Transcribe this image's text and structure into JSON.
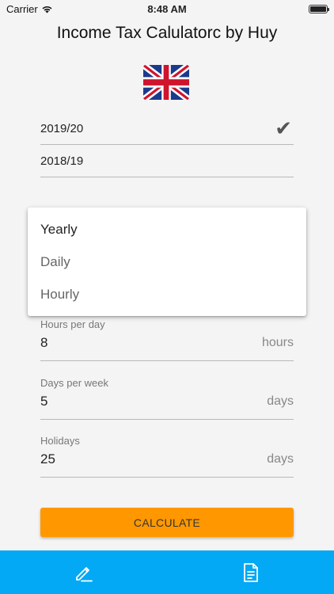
{
  "status": {
    "carrier": "Carrier",
    "time": "8:48 AM"
  },
  "app": {
    "title": "Income Tax Calulatorc by Huy"
  },
  "years": [
    {
      "label": "2019/20",
      "selected": true
    },
    {
      "label": "2018/19",
      "selected": false
    }
  ],
  "period_dropdown": {
    "options": [
      "Yearly",
      "Daily",
      "Hourly"
    ],
    "selected": "Yearly"
  },
  "fields": {
    "hours_per_day": {
      "label": "Hours per day",
      "value": "8",
      "unit": "hours"
    },
    "days_per_week": {
      "label": "Days per week",
      "value": "5",
      "unit": "days"
    },
    "holidays": {
      "label": "Holidays",
      "value": "25",
      "unit": "days"
    }
  },
  "calculate_button": {
    "label": "CALCULATE"
  },
  "colors": {
    "accent": "#ff9800",
    "tab_bar": "#03a9f4"
  },
  "icons": {
    "flag": "uk-flag-icon",
    "edit": "pencil-icon",
    "document": "document-icon",
    "check": "check-icon"
  }
}
